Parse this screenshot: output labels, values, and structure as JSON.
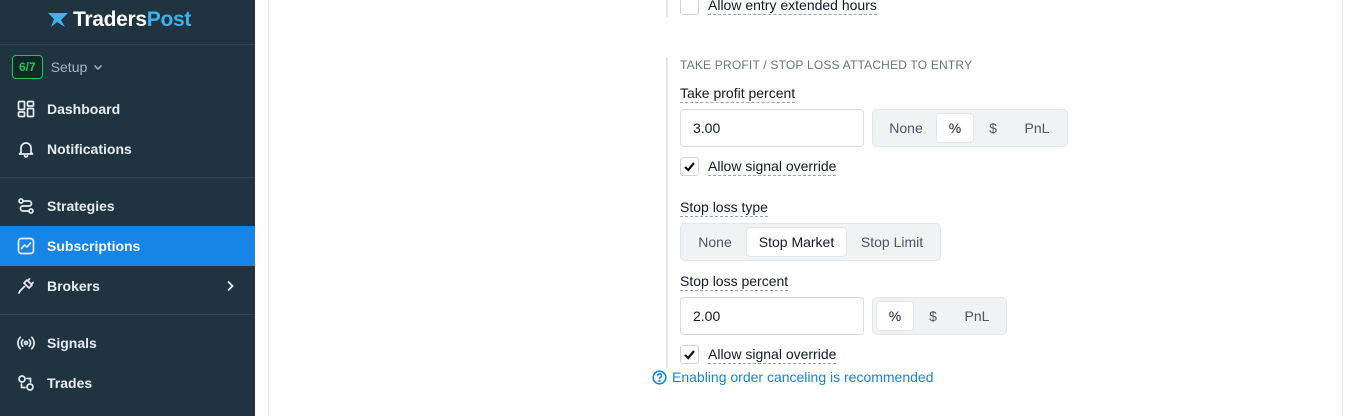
{
  "brand": {
    "part1": "Traders",
    "part2": "Post"
  },
  "setup": {
    "progress": "6/7",
    "label": "Setup"
  },
  "nav": {
    "dashboard": "Dashboard",
    "notifications": "Notifications",
    "strategies": "Strategies",
    "subscriptions": "Subscriptions",
    "brokers": "Brokers",
    "signals": "Signals",
    "trades": "Trades"
  },
  "form": {
    "extended_hours_label": "Allow entry extended hours",
    "tp_sl_heading": "TAKE PROFIT / STOP LOSS ATTACHED TO ENTRY",
    "take_profit": {
      "label": "Take profit percent",
      "value": "3.00",
      "units": [
        "None",
        "%",
        "$",
        "PnL"
      ],
      "selected_unit": "%",
      "override_label": "Allow signal override",
      "override_checked": true
    },
    "stop_loss_type": {
      "label": "Stop loss type",
      "options": [
        "None",
        "Stop Market",
        "Stop Limit"
      ],
      "selected": "Stop Market"
    },
    "stop_loss": {
      "label": "Stop loss percent",
      "value": "2.00",
      "units": [
        "%",
        "$",
        "PnL"
      ],
      "selected_unit": "%",
      "override_label": "Allow signal override",
      "override_checked": true
    },
    "info_note": "Enabling order canceling is recommended"
  },
  "colors": {
    "sidebar_bg": "#1f3340",
    "active_bg": "#1685e6",
    "brand_accent": "#3fb1ec",
    "setup_badge": "#22c55e",
    "info_link": "#1684d8"
  }
}
